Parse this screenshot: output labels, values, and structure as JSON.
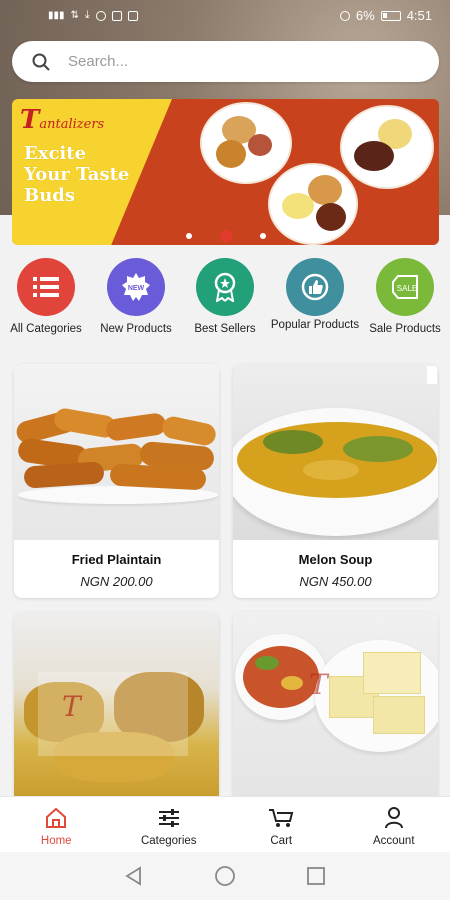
{
  "status_bar": {
    "battery": "6%",
    "time": "4:51"
  },
  "search": {
    "placeholder": "Search..."
  },
  "banner": {
    "logo_letter": "T",
    "logo_text": "antalizers",
    "tagline": "Excite Your Taste Buds",
    "slides": 3,
    "active_slide": 2
  },
  "categories": [
    {
      "label": "All Categories",
      "color": "#e0443a",
      "icon": "list-icon"
    },
    {
      "label": "New Products",
      "color": "#6a5bd8",
      "icon": "new-badge-icon"
    },
    {
      "label": "Best Sellers",
      "color": "#22a07a",
      "icon": "award-ribbon-icon"
    },
    {
      "label": "Popular Products",
      "color": "#3f8f9e",
      "icon": "thumbs-up-badge-icon"
    },
    {
      "label": "Sale Products",
      "color": "#7ab93a",
      "icon": "sale-tag-icon"
    }
  ],
  "products": [
    {
      "name": "Fried Plaintain",
      "price": "NGN 200.00"
    },
    {
      "name": "Melon Soup",
      "price": "NGN 450.00"
    },
    {
      "name": "",
      "price": ""
    },
    {
      "name": "",
      "price": ""
    }
  ],
  "tabbar": [
    {
      "label": "Home",
      "icon": "home-icon",
      "active": true
    },
    {
      "label": "Categories",
      "icon": "sliders-icon",
      "active": false
    },
    {
      "label": "Cart",
      "icon": "cart-icon",
      "active": false
    },
    {
      "label": "Account",
      "icon": "user-icon",
      "active": false
    }
  ],
  "colors": {
    "accent": "#e04a3a",
    "banner_red": "#c8421e",
    "banner_yellow": "#f6d32e"
  }
}
